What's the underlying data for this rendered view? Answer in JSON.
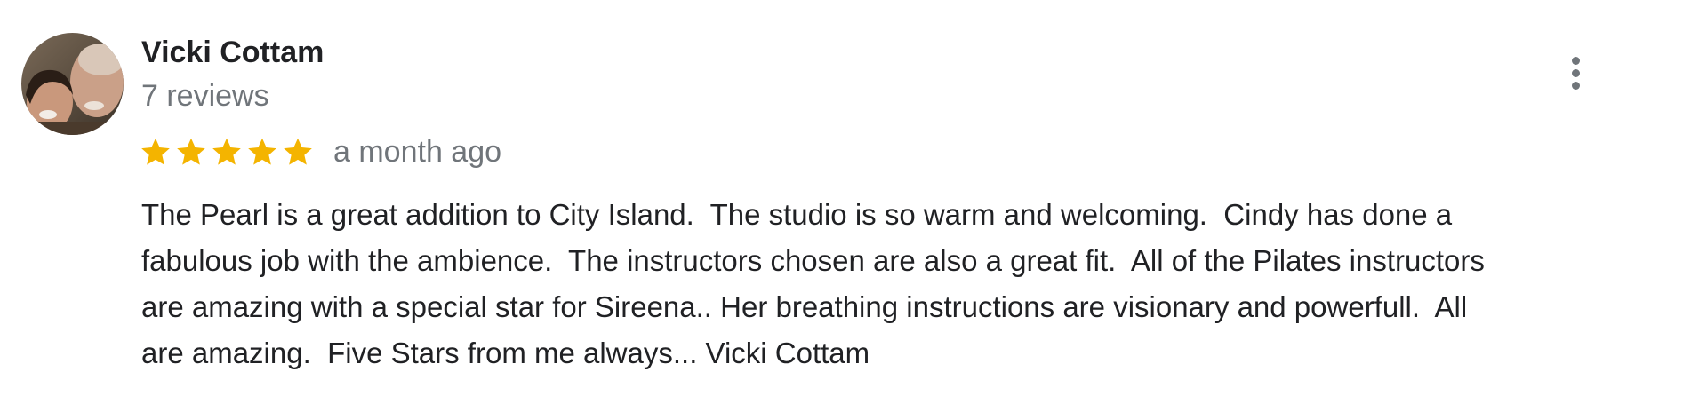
{
  "review": {
    "author": {
      "name": "Vicki Cottam",
      "review_count": "7 reviews",
      "avatar_icon": "user-photo-avatar"
    },
    "rating": {
      "stars": 5,
      "max": 5,
      "star_color": "#f4b400",
      "star_icon": "star-icon"
    },
    "date": "a month ago",
    "lines": [
      "The Pearl is a great addition to City Island.  The studio is so warm and welcoming.  Cindy has done a",
      "fabulous job with the ambience.  The instructors chosen are also a great fit.  All of the Pilates instructors",
      "are amazing with a special star for Sireena.. Her breathing instructions are visionary and powerfull.  All",
      "are amazing.  Five Stars from me always... Vicki Cottam"
    ],
    "menu_icon": "more-vertical-icon"
  },
  "colors": {
    "primary_text": "#202124",
    "secondary_text": "#70757a"
  }
}
